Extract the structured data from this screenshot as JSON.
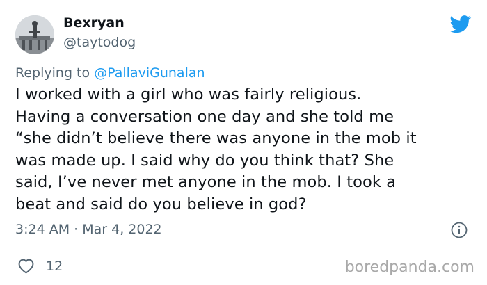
{
  "user": {
    "display_name": "Bexryan",
    "handle": "@taytodog"
  },
  "reply": {
    "prefix": "Replying to ",
    "mention": "@PallaviGunalan"
  },
  "tweet": {
    "text": "I worked with a girl who was fairly religious.\nHaving a conversation one day and she told me\n“she didn’t believe there was anyone in the mob it\nwas made up. I said why do you think that? She\nsaid, I’ve never met anyone in the mob. I took a\nbeat and said do you believe in god?",
    "timestamp": "3:24 AM · Mar 4, 2022"
  },
  "engagement": {
    "likes": "12"
  },
  "watermark": "boredpanda.com",
  "icons": {
    "logo": "twitter-bird-icon",
    "info": "info-icon",
    "like": "heart-icon"
  },
  "colors": {
    "twitter_blue": "#1d9bf0",
    "secondary_text": "#536471",
    "primary_text": "#0f1419",
    "divider": "#cfd9de",
    "watermark": "#a9a9a9"
  }
}
